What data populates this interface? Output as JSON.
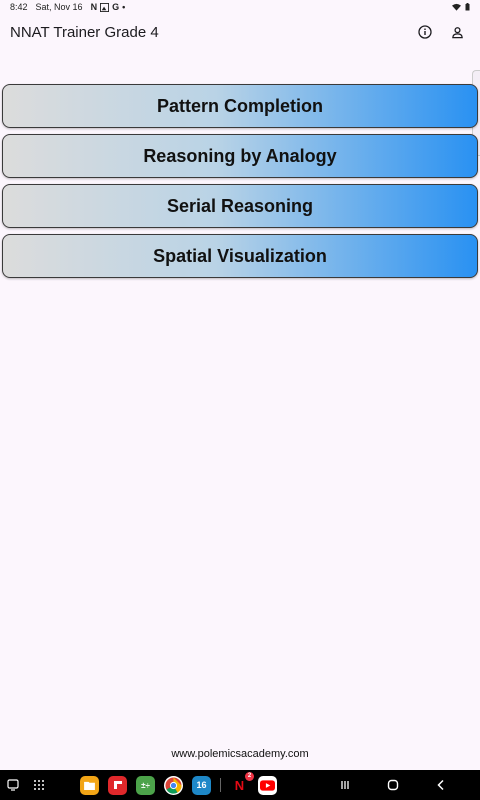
{
  "status": {
    "time": "8:42",
    "date": "Sat, Nov 16",
    "notifications": [
      "N",
      "G"
    ]
  },
  "app": {
    "title": "NNAT Trainer Grade 4",
    "info_icon": "info-icon",
    "account_icon": "person-icon"
  },
  "menu": {
    "items": [
      {
        "label": "Pattern Completion"
      },
      {
        "label": "Reasoning by Analogy"
      },
      {
        "label": "Serial Reasoning"
      },
      {
        "label": "Spatial Visualization"
      }
    ]
  },
  "footer": {
    "link": "www.polemicsacademy.com"
  },
  "navbar": {
    "dock_apps": [
      "files",
      "flipboard",
      "calculator",
      "chrome",
      "calendar",
      "netflix",
      "youtube"
    ],
    "calendar_day": "16",
    "netflix_badge": "2"
  },
  "colors": {
    "gradient_start": "#dcdcdc",
    "gradient_end": "#2991f2",
    "background": "#fcf6fd"
  }
}
